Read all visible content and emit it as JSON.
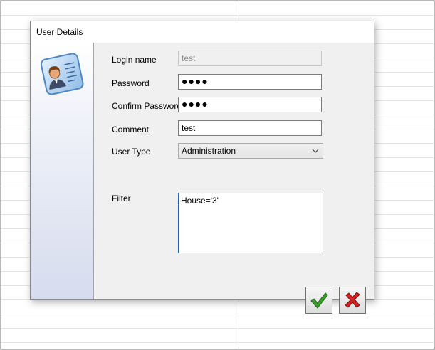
{
  "dialog": {
    "title": "User Details"
  },
  "form": {
    "login_name": {
      "label": "Login name",
      "value": "test"
    },
    "password": {
      "label": "Password",
      "value": "●●●●"
    },
    "confirm_password": {
      "label": "Confirm Password",
      "value": "●●●●"
    },
    "comment": {
      "label": "Comment",
      "value": "test"
    },
    "user_type": {
      "label": "User Type",
      "selected": "Administration"
    },
    "filter": {
      "label": "Filter",
      "value": "House='3'"
    }
  },
  "icons": {
    "user_card": "id-card-user-icon",
    "ok": "checkmark-icon",
    "cancel": "red-x-icon"
  },
  "colors": {
    "ok_green": "#3a9c2a",
    "cancel_red": "#d42020",
    "focus_border": "#1c67b4"
  }
}
